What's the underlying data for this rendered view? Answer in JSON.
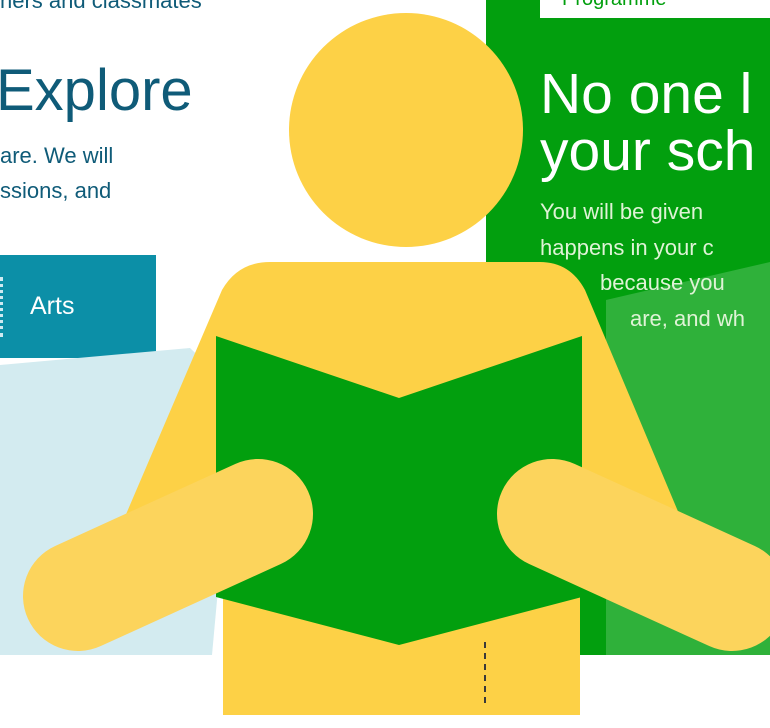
{
  "left": {
    "top_text": "hers and classmates",
    "title": "Explore",
    "line1": "are. We will",
    "line2": "ssions, and",
    "tab_label": "Arts"
  },
  "right": {
    "pill_label": "Programme",
    "title_line1": "No one l",
    "title_line2": "your sch",
    "text_lines": [
      "You will be given",
      "happens in your c",
      "because you",
      "are, and wh"
    ]
  },
  "colors": {
    "navy_text": "#0f5b78",
    "teal_tab": "#0c8fa7",
    "green": "#029f0e",
    "light_green": "#2fb13a",
    "light_blue": "#d3ebf0",
    "yellow": "#fdd146",
    "yellow_light": "#fcd45c"
  },
  "icons": {
    "figure": "reading-person-illustration"
  }
}
